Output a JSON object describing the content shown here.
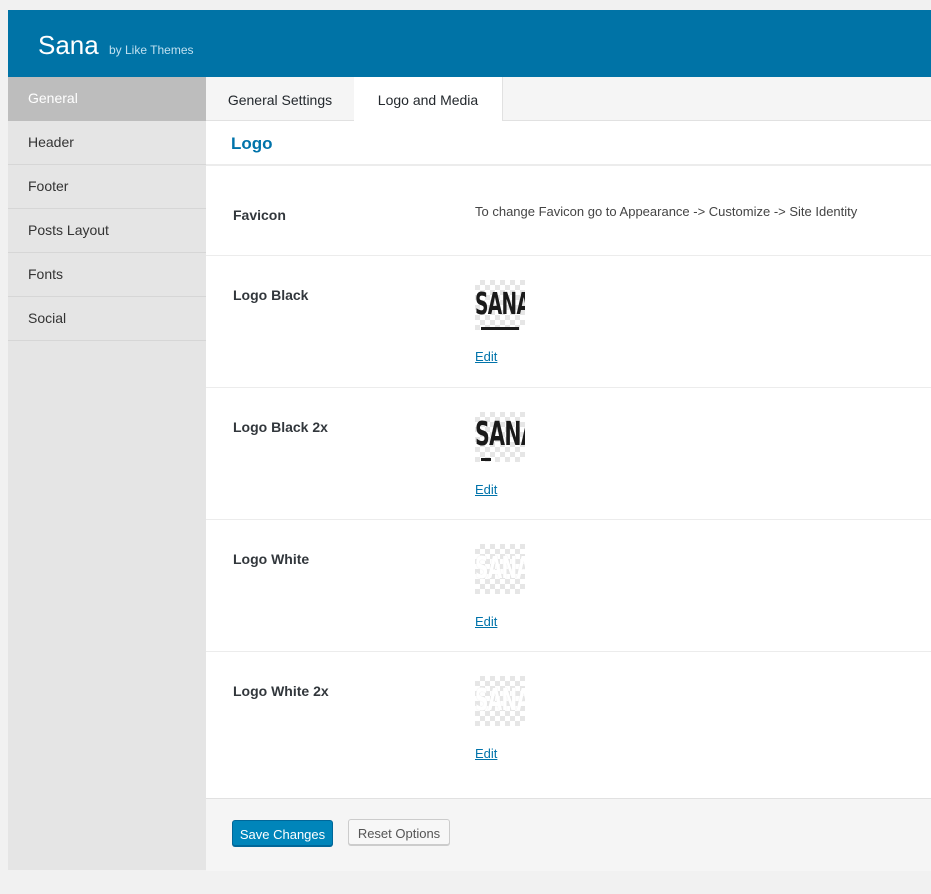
{
  "header": {
    "title": "Sana",
    "subtitle": "by Like Themes",
    "bg_color": "#0073a6"
  },
  "sidebar": {
    "items": [
      {
        "label": "General",
        "active": true
      },
      {
        "label": "Header",
        "active": false
      },
      {
        "label": "Footer",
        "active": false
      },
      {
        "label": "Posts Layout",
        "active": false
      },
      {
        "label": "Fonts",
        "active": false
      },
      {
        "label": "Social",
        "active": false
      }
    ]
  },
  "tabs": [
    {
      "label": "General Settings",
      "active": false
    },
    {
      "label": "Logo and Media",
      "active": true
    }
  ],
  "section": {
    "title": "Logo"
  },
  "fields": {
    "favicon": {
      "label": "Favicon",
      "text": "To change Favicon go to Appearance -> Customize -> Site Identity"
    },
    "logo_black": {
      "label": "Logo Black",
      "thumb_text": "SANA",
      "edit_label": "Edit"
    },
    "logo_black_2x": {
      "label": "Logo Black 2x",
      "thumb_text": "SANA",
      "edit_label": "Edit"
    },
    "logo_white": {
      "label": "Logo White",
      "thumb_text": "SANA",
      "edit_label": "Edit"
    },
    "logo_white_2x": {
      "label": "Logo White 2x",
      "thumb_text": "SANA",
      "edit_label": "Edit"
    }
  },
  "actions": {
    "save_label": "Save Changes",
    "reset_label": "Reset Options"
  },
  "colors": {
    "accent": "#0073aa",
    "primary_button": "#0085ba"
  }
}
